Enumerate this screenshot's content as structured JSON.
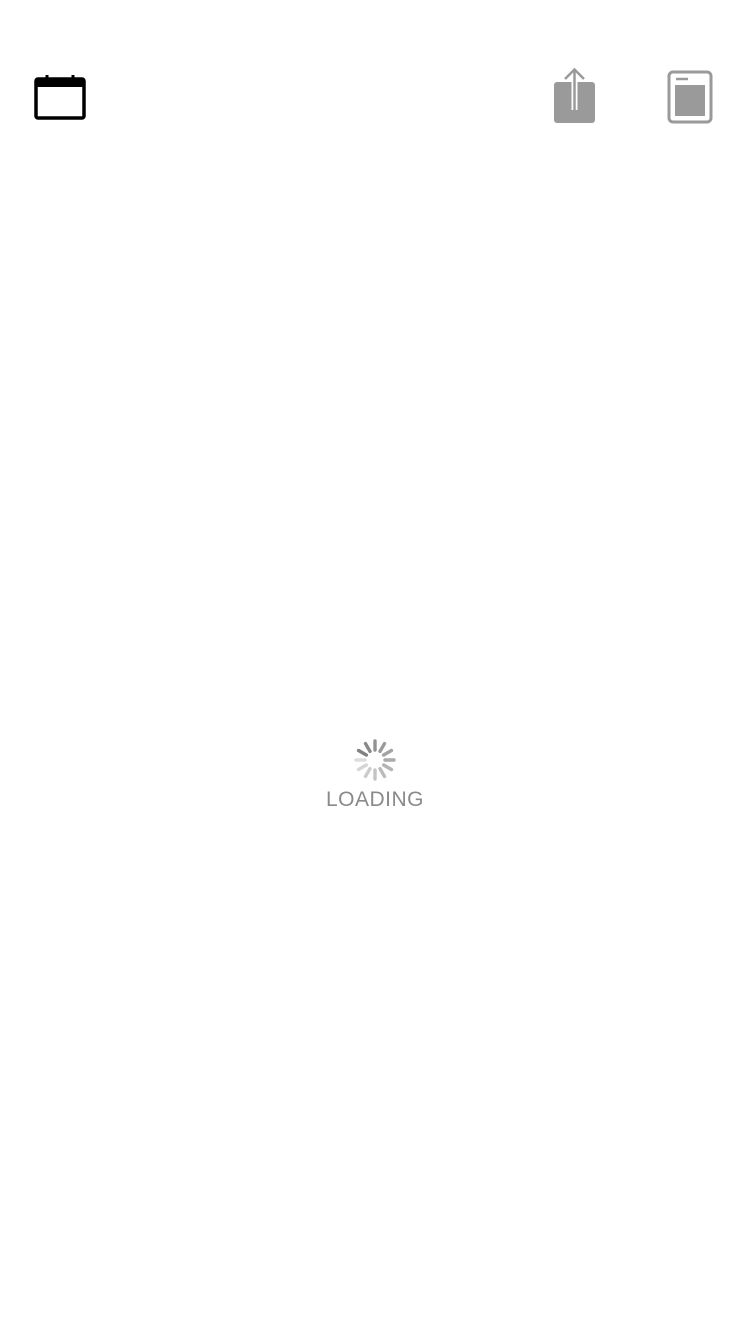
{
  "toolbar": {
    "left_icon": "calendar-icon",
    "right_icons": [
      "share-icon",
      "reader-mode-icon"
    ],
    "colors": {
      "active_icon": "#000000",
      "inactive_icon": "#8e8e8e"
    }
  },
  "loading": {
    "label": "LOADING",
    "indicator": "spinner-icon",
    "color": "#8a8a8a"
  }
}
